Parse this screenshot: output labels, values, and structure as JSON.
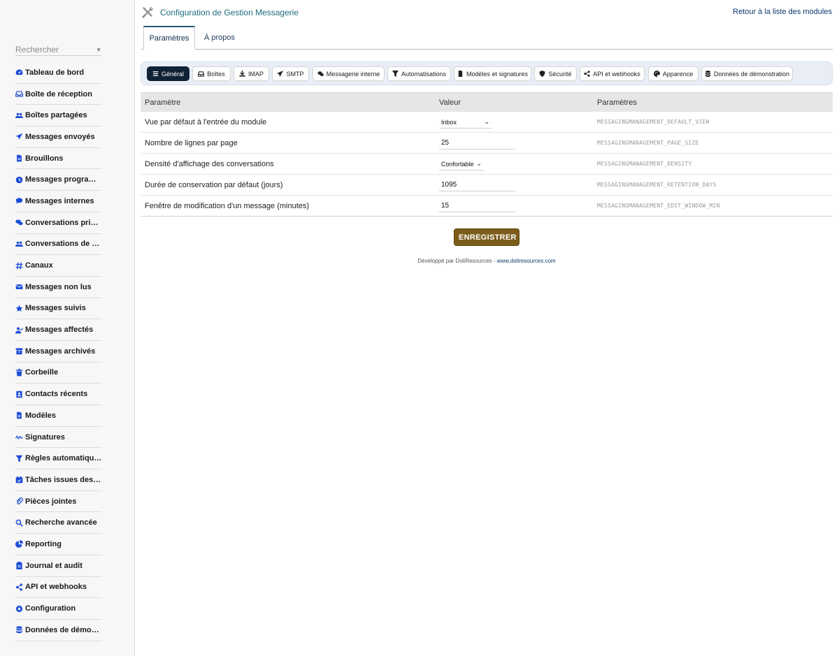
{
  "sidebar": {
    "search_placeholder": "Rechercher",
    "items": [
      {
        "label": "Tableau de bord",
        "icon": "gauge-icon"
      },
      {
        "label": "Boîte de réception",
        "icon": "inbox-icon"
      },
      {
        "label": "Boîtes partagées",
        "icon": "users-icon"
      },
      {
        "label": "Messages envoyés",
        "icon": "paper-plane-icon"
      },
      {
        "label": "Brouillons",
        "icon": "file-icon"
      },
      {
        "label": "Messages programmés",
        "icon": "clock-icon"
      },
      {
        "label": "Messages internes",
        "icon": "comment-icon"
      },
      {
        "label": "Conversations privées",
        "icon": "comments-icon"
      },
      {
        "label": "Conversations de groupe",
        "icon": "user-group-icon"
      },
      {
        "label": "Canaux",
        "icon": "hashtag-icon"
      },
      {
        "label": "Messages non lus",
        "icon": "envelope-icon"
      },
      {
        "label": "Messages suivis",
        "icon": "star-icon"
      },
      {
        "label": "Messages affectés",
        "icon": "user-check-icon"
      },
      {
        "label": "Messages archivés",
        "icon": "archive-icon"
      },
      {
        "label": "Corbeille",
        "icon": "trash-icon"
      },
      {
        "label": "Contacts récents",
        "icon": "address-book-icon"
      },
      {
        "label": "Modèles",
        "icon": "file-lines-icon"
      },
      {
        "label": "Signatures",
        "icon": "signature-icon"
      },
      {
        "label": "Règles automatiques",
        "icon": "filter-icon"
      },
      {
        "label": "Tâches issues des messages",
        "icon": "calendar-check-icon"
      },
      {
        "label": "Pièces jointes",
        "icon": "paperclip-icon"
      },
      {
        "label": "Recherche avancée",
        "icon": "search-icon"
      },
      {
        "label": "Reporting",
        "icon": "chart-pie-icon"
      },
      {
        "label": "Journal et audit",
        "icon": "clipboard-icon"
      },
      {
        "label": "API et webhooks",
        "icon": "share-nodes-icon"
      },
      {
        "label": "Configuration",
        "icon": "gear-icon"
      },
      {
        "label": "Données de démonstration",
        "icon": "database-icon"
      }
    ]
  },
  "header": {
    "title": "Configuration de Gestion Messagerie",
    "back_link": "Retour à la liste des modules"
  },
  "tabs": [
    "Paramètres",
    "À propos"
  ],
  "subnav": [
    {
      "label": "Général",
      "icon": "bars-icon",
      "active": true
    },
    {
      "label": "Boîtes",
      "icon": "inbox-icon"
    },
    {
      "label": "IMAP",
      "icon": "download-icon"
    },
    {
      "label": "SMTP",
      "icon": "paper-plane-icon"
    },
    {
      "label": "Messagerie interne",
      "icon": "comments-icon"
    },
    {
      "label": "Automatisations",
      "icon": "filter-icon"
    },
    {
      "label": "Modèles et signatures",
      "icon": "file-icon"
    },
    {
      "label": "Sécurité",
      "icon": "shield-icon"
    },
    {
      "label": "API et webhooks",
      "icon": "share-nodes-icon"
    },
    {
      "label": "Apparence",
      "icon": "palette-icon"
    },
    {
      "label": "Données de démonstration",
      "icon": "database-icon"
    }
  ],
  "table": {
    "headers": [
      "Paramètre",
      "Valeur",
      "Paramètres"
    ],
    "rows": [
      {
        "label": "Vue par défaut à l'entrée du module",
        "type": "select",
        "value": "Inbox",
        "const": "MESSAGINGMANAGEMENT_DEFAULT_VIEW"
      },
      {
        "label": "Nombre de lignes par page",
        "type": "input",
        "value": "25",
        "const": "MESSAGINGMANAGEMENT_PAGE_SIZE"
      },
      {
        "label": "Densité d'affichage des conversations",
        "type": "select",
        "value": "Confortable",
        "const": "MESSAGINGMANAGEMENT_DENSITY"
      },
      {
        "label": "Durée de conservation par défaut (jours)",
        "type": "input",
        "value": "1095",
        "const": "MESSAGINGMANAGEMENT_RETENTION_DAYS"
      },
      {
        "label": "Fenêtre de modification d'un message (minutes)",
        "type": "input",
        "value": "15",
        "const": "MESSAGINGMANAGEMENT_EDIT_WINDOW_MIN"
      }
    ]
  },
  "save_label": "ENREGISTRER",
  "footer": {
    "prefix": "Développé par DoliResources - ",
    "link": "www.doliresources.com"
  },
  "colors": {
    "accent_blue": "#1d4ed8",
    "save_button": "#7b5c1a",
    "active_pill": "#102235",
    "title": "#1e6d7d"
  }
}
